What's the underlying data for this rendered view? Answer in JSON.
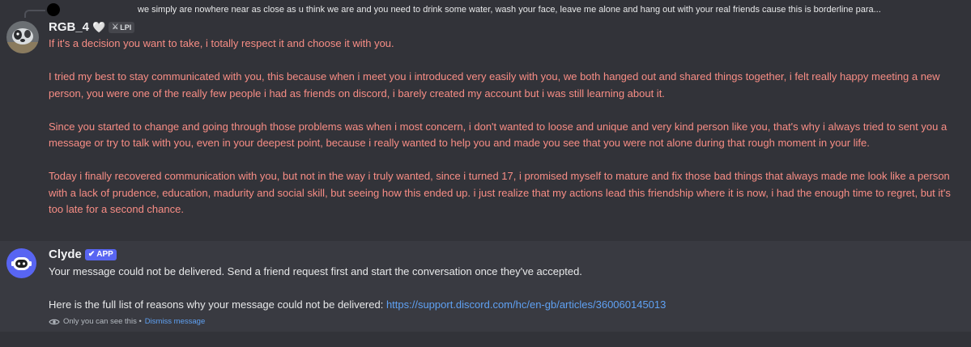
{
  "reply": {
    "text": "we simply are nowhere near as close as u think we are and you need to drink some water, wash your face, leave me alone and hang out with your real friends cause this is borderline para..."
  },
  "message1": {
    "username": "RGB_4",
    "heart": "🤍",
    "tag_icon": "⚔",
    "tag": "LPI",
    "paragraphs": [
      "If it's a decision you want to take, i totally respect it and choose it with you.",
      "I tried my best to stay communicated with you, this because when i meet you i introduced very easily with you, we both hanged out and shared things together, i felt really happy meeting a new person, you were one of the really few people i had as friends on discord, i barely created my account but i was still learning about it.",
      "Since you started to change and going through those problems was when i most concern, i don't wanted to loose and unique and very kind person like you, that's why i always tried to sent you a message or try to talk with you, even in your deepest point, because i really wanted to help you and made you see that you were not alone during that rough moment in your life.",
      "Today i finally recovered communication with you, but not in the way i truly wanted, since i turned 17, i promised myself to mature and fix those bad things that always made me look like a person with a lack of prudence, education, madurity and social skill, but seeing how this ended up. i just realize that my actions lead this friendship where it is now, i had the enough time to regret, but it's too late for a second chance."
    ]
  },
  "message2": {
    "username": "Clyde",
    "badge_check": "✔",
    "badge": "APP",
    "line1": "Your message could not be delivered. Send a friend request first and start the conversation once they've accepted.",
    "line2_prefix": "Here is the full list of reasons why your message could not be delivered: ",
    "link": "https://support.discord.com/hc/en-gb/articles/360060145013",
    "ephemeral_note": "Only you can see this • ",
    "dismiss": "Dismiss message"
  },
  "colors": {
    "background": "#323339",
    "highlight": "#393a41",
    "message_text_red": "#f88d85",
    "link": "#5fa1f3",
    "app_badge": "#5865f2"
  },
  "icons": [
    "reply-avatar",
    "user-avatar",
    "heart-icon",
    "sword-icon",
    "clyde-avatar",
    "checkmark-icon",
    "eye-icon"
  ]
}
